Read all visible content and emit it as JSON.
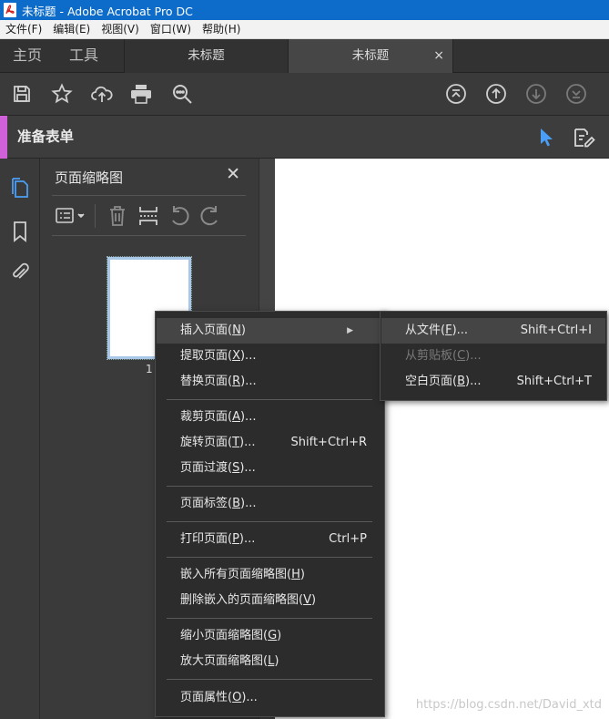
{
  "window": {
    "title": "未标题 - Adobe Acrobat Pro DC",
    "app_icon": "acrobat-icon"
  },
  "menubar": {
    "items": [
      "文件(F)",
      "编辑(E)",
      "视图(V)",
      "窗口(W)",
      "帮助(H)"
    ]
  },
  "tabs": {
    "home": "主页",
    "tools": "工具",
    "doc_tabs": [
      "未标题",
      "未标题"
    ],
    "close_glyph": "×"
  },
  "toolbar": {
    "icons": [
      "save-icon",
      "star-icon",
      "cloud-upload-icon",
      "print-icon",
      "zoom-search-icon",
      "first-page-icon",
      "prev-page-icon",
      "next-page-icon",
      "last-page-icon"
    ]
  },
  "form_bar": {
    "title": "准备表单",
    "accent_color": "#d061d8"
  },
  "panel": {
    "title": "页面缩略图",
    "close_glyph": "✕",
    "thumbnail_page": "1"
  },
  "context_menu": {
    "items": [
      {
        "label": "插入页面(N)",
        "underline": "N",
        "shortcut": "",
        "submenu": true
      },
      {
        "label": "提取页面(X)...",
        "underline": "X",
        "shortcut": ""
      },
      {
        "label": "替换页面(R)...",
        "underline": "R",
        "shortcut": ""
      },
      {
        "label": "裁剪页面(A)...",
        "underline": "A",
        "shortcut": ""
      },
      {
        "label": "旋转页面(T)...",
        "underline": "T",
        "shortcut": "Shift+Ctrl+R"
      },
      {
        "label": "页面过渡(S)...",
        "underline": "S",
        "shortcut": ""
      },
      {
        "label": "页面标签(B)...",
        "underline": "B",
        "shortcut": ""
      },
      {
        "label": "打印页面(P)...",
        "underline": "P",
        "shortcut": "Ctrl+P"
      },
      {
        "label": "嵌入所有页面缩略图(H)",
        "underline": "H",
        "shortcut": ""
      },
      {
        "label": "删除嵌入的页面缩略图(V)",
        "underline": "V",
        "shortcut": ""
      },
      {
        "label": "缩小页面缩略图(G)",
        "underline": "G",
        "shortcut": ""
      },
      {
        "label": "放大页面缩略图(L)",
        "underline": "L",
        "shortcut": ""
      },
      {
        "label": "页面属性(O)...",
        "underline": "O",
        "shortcut": ""
      }
    ]
  },
  "submenu": {
    "items": [
      {
        "label": "从文件(F)...",
        "underline": "F",
        "shortcut": "Shift+Ctrl+I",
        "disabled": false
      },
      {
        "label": "从剪贴板(C)...",
        "underline": "C",
        "shortcut": "",
        "disabled": true
      },
      {
        "label": "空白页面(B)...",
        "underline": "B",
        "shortcut": "Shift+Ctrl+T",
        "disabled": false
      }
    ]
  },
  "watermark": "https://blog.csdn.net/David_xtd"
}
